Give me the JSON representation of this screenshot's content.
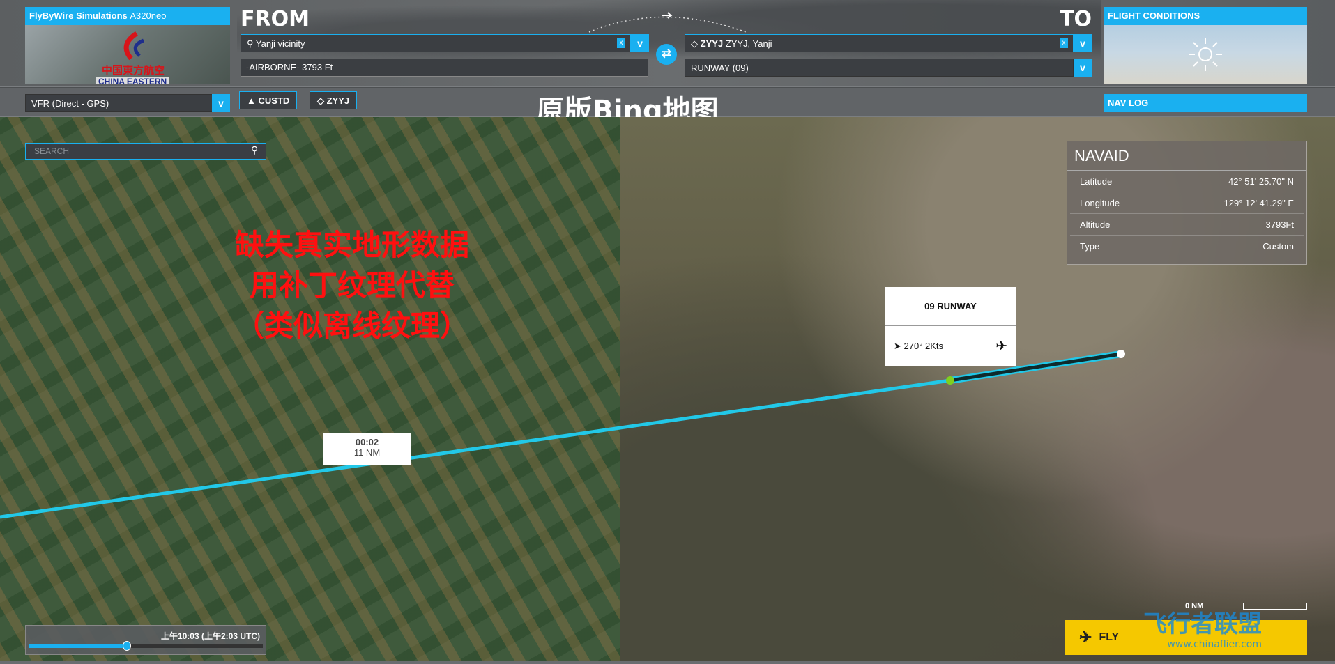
{
  "aircraft": {
    "title_bold": "FlyByWire Simulations",
    "title_model": "A320neo",
    "livery_cn": "中国東方航空",
    "livery_en": "CHINA EASTERN"
  },
  "from": {
    "label": "FROM",
    "location": "Yanji vicinity",
    "detail": "-AIRBORNE- 3793 Ft",
    "clear": "x",
    "chevron": "v"
  },
  "to": {
    "label": "TO",
    "icao": "ZYYJ",
    "location": "ZYYJ, Yanji",
    "runway": "RUNWAY (09)",
    "clear": "x",
    "chevron": "v"
  },
  "flight_conditions": {
    "label": "FLIGHT CONDITIONS",
    "weather_icon": "sun-icon"
  },
  "flight_plan": {
    "type": "VFR (Direct - GPS)",
    "chevron": "v",
    "waypoints": [
      {
        "icon": "triangle-icon",
        "label": "CUSTD"
      },
      {
        "icon": "airport-icon",
        "label": "ZYYJ"
      }
    ]
  },
  "overlay_title": "原版Bing地图",
  "nav_log": "NAV LOG",
  "search": {
    "placeholder": "SEARCH"
  },
  "annotation": [
    "缺失真实地形数据",
    "用补丁纹理代替",
    "（类似离线纹理）"
  ],
  "navaid": {
    "title": "NAVAID",
    "rows": [
      {
        "label": "Latitude",
        "value": "42° 51' 25.70\" N"
      },
      {
        "label": "Longitude",
        "value": "129° 12' 41.29\" E"
      },
      {
        "label": "Altitude",
        "value": "3793Ft"
      },
      {
        "label": "Type",
        "value": "Custom"
      }
    ]
  },
  "runway_popup": {
    "title": "09 RUNWAY",
    "wind": "270° 2Kts"
  },
  "leg": {
    "time": "00:02",
    "distance": "11 NM"
  },
  "time": {
    "label": "上午10:03 (上午2:03 UTC)",
    "slider_fraction": 0.42
  },
  "scale": {
    "label": "0 NM"
  },
  "fly": {
    "label": "FLY"
  },
  "watermark": {
    "cn": "飞行者联盟",
    "url": "www.chinaflier.com"
  },
  "colors": {
    "accent": "#1ab0f0",
    "route": "#22c8e8",
    "fly": "#f5c800",
    "annotation": "#ff1010"
  }
}
